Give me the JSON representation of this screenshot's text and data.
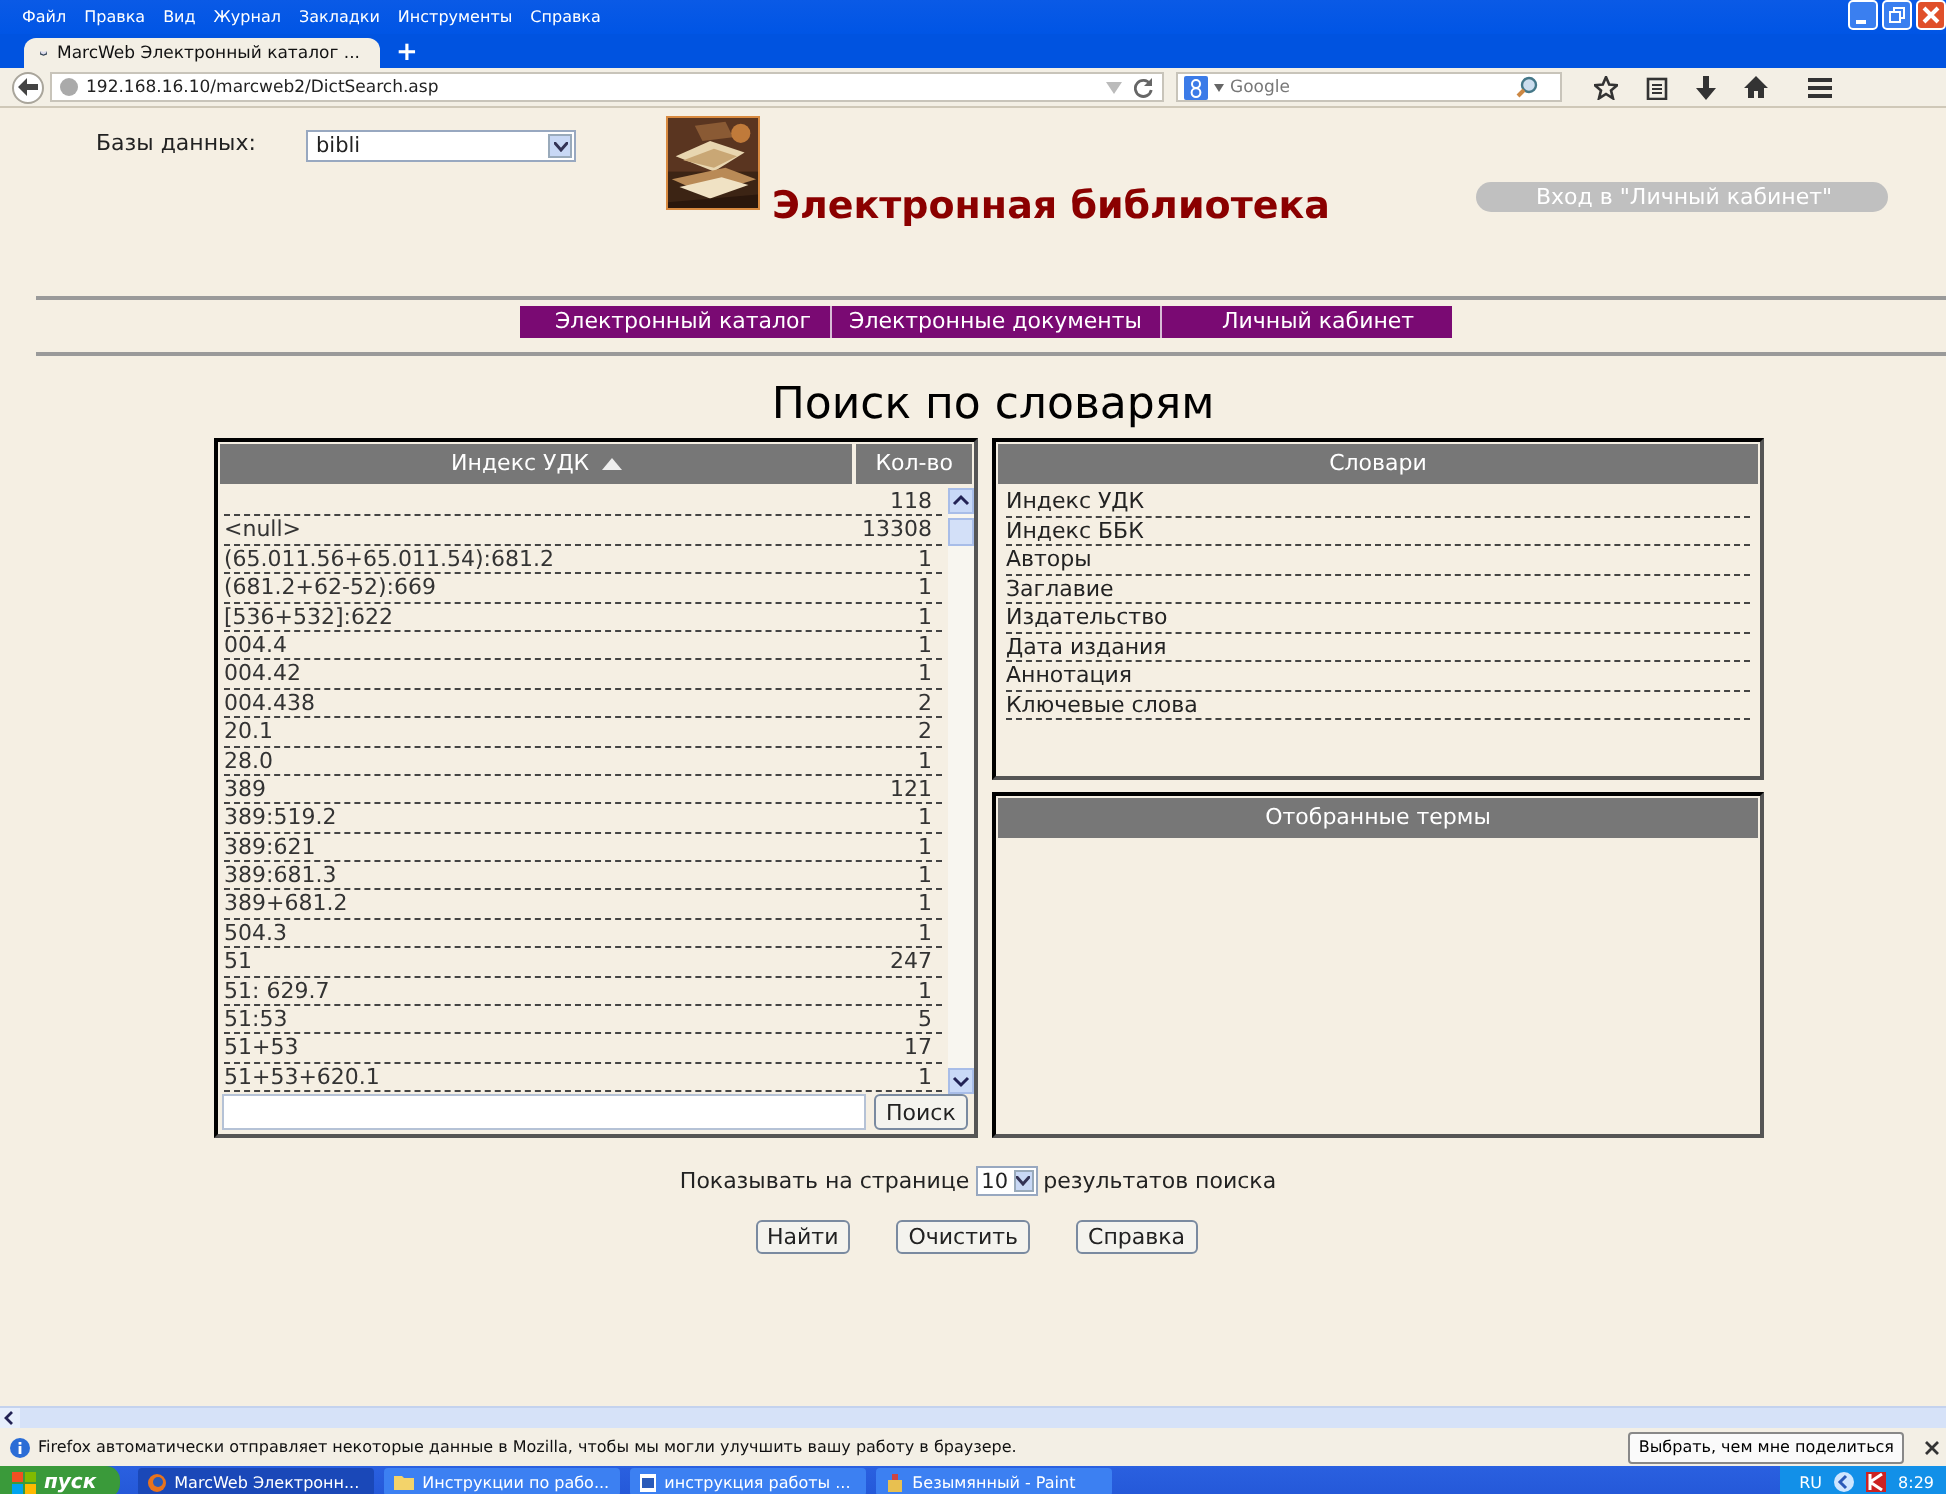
{
  "browser": {
    "menu": [
      "Файл",
      "Правка",
      "Вид",
      "Журнал",
      "Закладки",
      "Инструменты",
      "Справка"
    ],
    "tab": {
      "title": "MarcWeb Электронный каталог ...",
      "selected": true
    },
    "new_tab": "+",
    "url": "192.168.16.10/marcweb2/DictSearch.asp",
    "search": {
      "placeholder": "Google"
    }
  },
  "page": {
    "database": {
      "label": "Базы данных:",
      "value": "bibli"
    },
    "site_title": "Электронная библиотека",
    "login_button": "Вход в \"Личный кабинет\"",
    "nav": [
      "Электронный каталог",
      "Электронные документы",
      "Личный кабинет"
    ],
    "heading": "Поиск по словарям",
    "index_table": {
      "columns": [
        {
          "label": "Индекс УДК",
          "sorted": true
        },
        {
          "label": "Кол-во",
          "sorted": false
        }
      ],
      "rows": [
        {
          "count": "118"
        },
        {
          "term": "<null>",
          "count": "13308"
        },
        {
          "term": "(65.011.56+65.011.54):681.2",
          "count": "1"
        },
        {
          "term": "(681.2+62-52):669",
          "count": "1"
        },
        {
          "term": "[536+532]:622",
          "count": "1"
        },
        {
          "term": "004.4",
          "count": "1"
        },
        {
          "term": "004.42",
          "count": "1"
        },
        {
          "term": "004.438",
          "count": "2"
        },
        {
          "term": "20.1",
          "count": "2"
        },
        {
          "term": "28.0",
          "count": "1"
        },
        {
          "term": "389",
          "count": "121"
        },
        {
          "term": "389:519.2",
          "count": "1"
        },
        {
          "term": "389:621",
          "count": "1"
        },
        {
          "term": "389:681.3",
          "count": "1"
        },
        {
          "term": "389+681.2",
          "count": "1"
        },
        {
          "term": "504.3",
          "count": "1"
        },
        {
          "term": "51",
          "count": "247"
        },
        {
          "term": "51: 629.7",
          "count": "1"
        },
        {
          "term": "51:53",
          "count": "5"
        },
        {
          "term": "51+53",
          "count": "17"
        },
        {
          "term": "51+53+620.1",
          "count": "1"
        }
      ],
      "search_button": "Поиск"
    },
    "dictionaries": {
      "title": "Словари",
      "items": [
        "Индекс УДК",
        "Индекс ББК",
        "Авторы",
        "Заглавие",
        "Издательство",
        "Дата издания",
        "Аннотация",
        "Ключевые слова"
      ]
    },
    "selected_terms": {
      "title": "Отобранные термы"
    },
    "page_size": {
      "before": "Показывать на странице",
      "value": "10",
      "after": "результатов поиска"
    },
    "buttons": [
      "Найти",
      "Очистить",
      "Справка"
    ]
  },
  "notification": {
    "text": "Firefox автоматически отправляет некоторые данные в Mozilla, чтобы мы могли улучшить вашу работу в браузере.",
    "button": "Выбрать, чем мне поделиться"
  },
  "taskbar": {
    "start": "пуск",
    "tasks": [
      {
        "label": "MarcWeb Электронн...",
        "selected": true
      },
      {
        "label": "Инструкции по рабо...",
        "selected": false
      },
      {
        "label": "инструкция работы ...",
        "selected": false
      },
      {
        "label": "Безымянный - Paint",
        "selected": false
      }
    ],
    "language": "RU",
    "time": "8:29"
  }
}
